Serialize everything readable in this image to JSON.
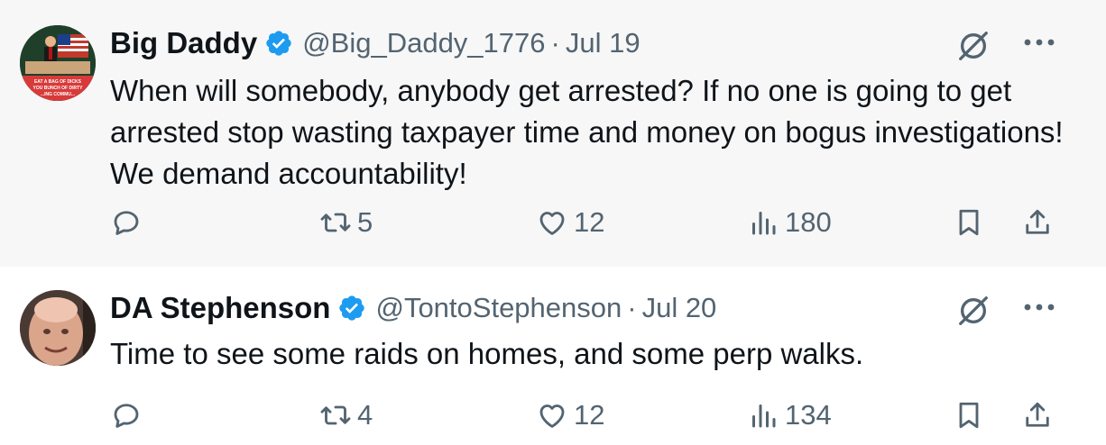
{
  "tweets": [
    {
      "display_name": "Big Daddy",
      "handle": "@Big_Daddy_1776",
      "date": "Jul 19",
      "text": "When will somebody, anybody get arrested? If no one is going to get arrested stop wasting taxpayer time and money on bogus investigations! We demand accountability!",
      "reposts": "5",
      "likes": "12",
      "views": "180",
      "avatar_text": "EAT A BAG OF DICKS YOU BUNCH OF DIRTY ...ING COMMU..."
    },
    {
      "display_name": "DA Stephenson",
      "handle": "@TontoStephenson",
      "date": "Jul 20",
      "text": "Time to see some raids on homes, and some perp walks.",
      "reposts": "4",
      "likes": "12",
      "views": "134"
    }
  ],
  "separator": "·",
  "icons": {
    "verified": "verified-badge-icon",
    "grok": "grok-icon",
    "more": "more-icon",
    "reply": "reply-icon",
    "repost": "repost-icon",
    "like": "like-icon",
    "views": "views-icon",
    "bookmark": "bookmark-icon",
    "share": "share-icon"
  },
  "colors": {
    "verified_blue": "#1d9bf0",
    "muted_text": "#536471",
    "primary_text": "#0f1419",
    "tweet1_bg": "#f7f7f7"
  }
}
